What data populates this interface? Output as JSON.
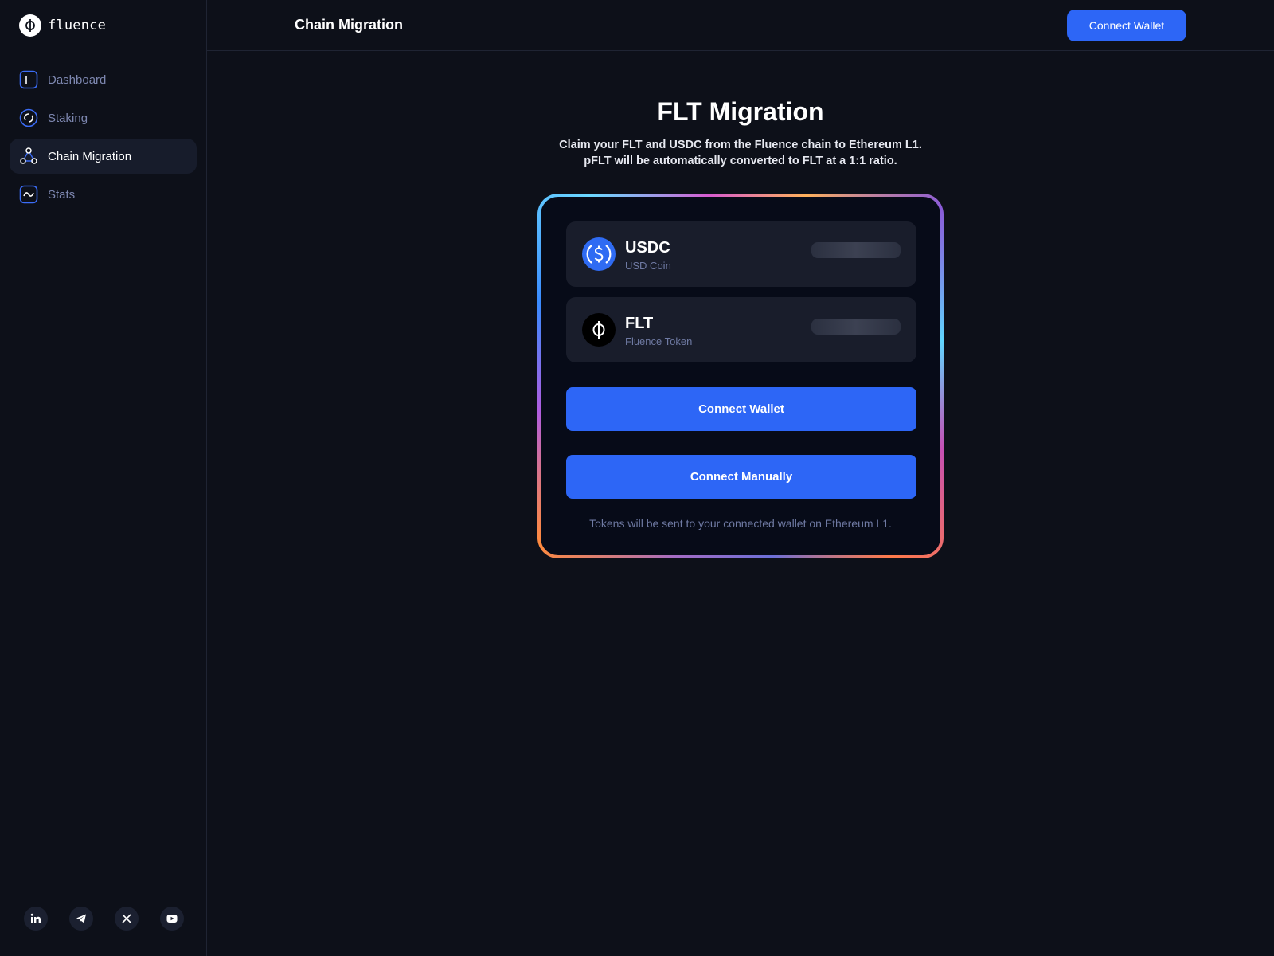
{
  "app": {
    "logo_text": "fluence",
    "logo_icon": "phi-icon"
  },
  "sidebar": {
    "items": [
      {
        "label": "Dashboard",
        "icon": "dashboard-icon",
        "active": false
      },
      {
        "label": "Staking",
        "icon": "staking-icon",
        "active": false
      },
      {
        "label": "Chain Migration",
        "icon": "chain-migration-icon",
        "active": true
      },
      {
        "label": "Stats",
        "icon": "stats-icon",
        "active": false
      }
    ],
    "socials": [
      "linkedin-icon",
      "telegram-icon",
      "x-icon",
      "youtube-icon"
    ]
  },
  "header": {
    "title": "Chain Migration",
    "connect_label": "Connect Wallet"
  },
  "main": {
    "title": "FLT Migration",
    "subtitle_line1": "Claim your FLT and USDC from the Fluence chain to Ethereum L1.",
    "subtitle_line2": "pFLT will be automatically converted to FLT at a 1:1 ratio.",
    "tokens": [
      {
        "symbol": "USDC",
        "name": "USD Coin",
        "icon": "usdc-icon"
      },
      {
        "symbol": "FLT",
        "name": "Fluence Token",
        "icon": "flt-icon"
      }
    ],
    "connect_wallet_label": "Connect Wallet",
    "connect_manually_label": "Connect Manually",
    "note": "Tokens will be sent to your connected wallet on Ethereum L1."
  },
  "colors": {
    "background": "#0d1019",
    "accent": "#2d66f6",
    "muted_text": "#7d87b0",
    "row_bg": "#191d2b"
  }
}
